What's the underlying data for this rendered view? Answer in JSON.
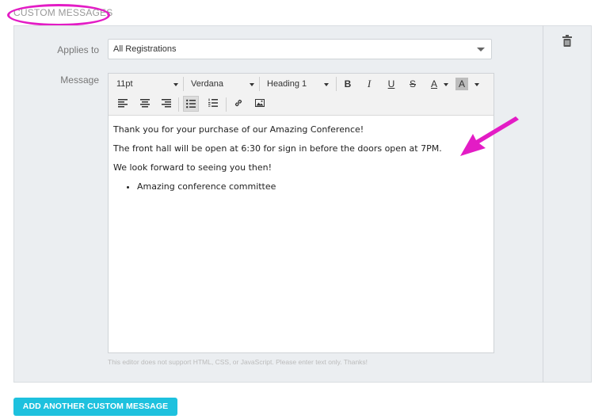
{
  "section": {
    "title": "CUSTOM MESSAGES"
  },
  "form": {
    "applies_label": "Applies to",
    "applies_value": "All Registrations",
    "message_label": "Message"
  },
  "toolbar": {
    "font_size": "11pt",
    "font_family": "Verdana",
    "block_format": "Heading 1",
    "bold": "B",
    "italic": "I",
    "underline": "U",
    "strike": "S",
    "font_color": "A",
    "bg_color": "A"
  },
  "content": {
    "line1": "Thank you for your purchase of our Amazing Conference!",
    "line2": "The front hall will be open at 6:30 for sign in before the doors open at 7PM.",
    "line3": "We look forward to seeing you then!",
    "bullets": [
      "Amazing conference committee"
    ]
  },
  "hint": "This editor does not support HTML, CSS, or JavaScript. Please enter text only. Thanks!",
  "add_button": "ADD ANOTHER CUSTOM MESSAGE",
  "colors": {
    "accent": "#1ec1de",
    "annotation": "#e31cc5"
  },
  "icons": [
    "trash-icon",
    "align-left-icon",
    "align-center-icon",
    "align-right-icon",
    "bullet-list-icon",
    "numbered-list-icon",
    "link-icon",
    "image-icon",
    "annotation-arrow-icon"
  ]
}
